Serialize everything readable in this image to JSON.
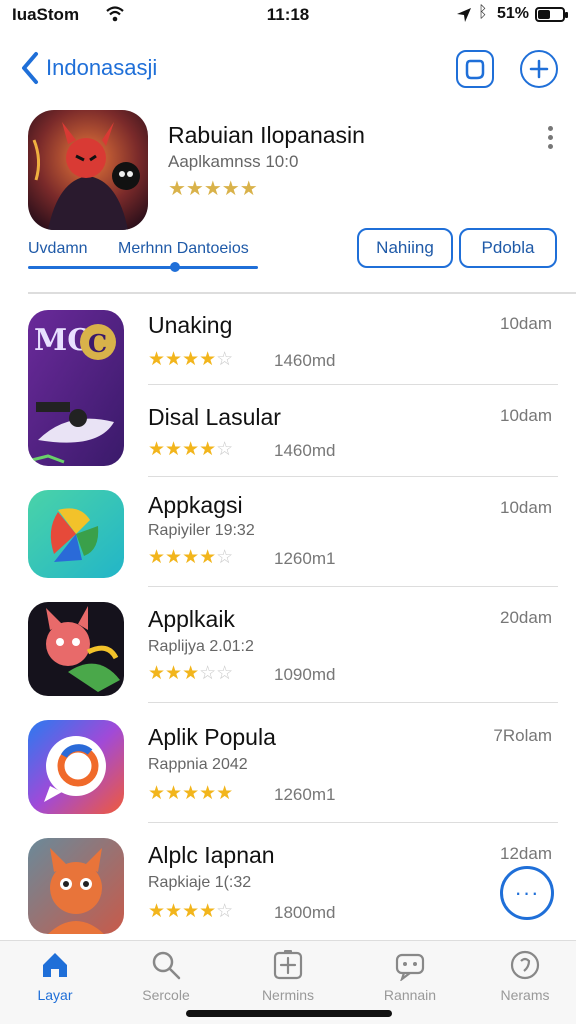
{
  "status_bar": {
    "carrier": "IuaStom",
    "time": "11:18",
    "battery_pct": "51%",
    "battery_level": 0.51,
    "icons": [
      "wifi-icon",
      "location-arrow-icon",
      "bluetooth-icon",
      "battery-icon"
    ]
  },
  "nav": {
    "back_label": "Indonasasji",
    "buttons": [
      "square-icon",
      "plus-icon"
    ]
  },
  "featured": {
    "title": "Rabuian Ilopanasin",
    "subtitle": "Aaplkamnss 10:0",
    "rating": 4,
    "stars": "★★★★★",
    "tab_left": "Uvdamn",
    "tab_right": "Merhnn Dantoeios",
    "slider_value": 0.64,
    "pill_one": "Nahiing",
    "pill_two": "Pdobla"
  },
  "apps": [
    {
      "title": "Unaking",
      "subtitle": "",
      "stars_on": "★★★★",
      "stars_off": "☆",
      "count": "1460md",
      "time": "10dam",
      "icon": "game-art-icon-purple"
    },
    {
      "title": "Disal Lasular",
      "subtitle": "",
      "stars_on": "★★★★",
      "stars_off": "☆",
      "count": "1460md",
      "time": "10dam",
      "icon": "game-art-icon-purple"
    },
    {
      "title": "Appkagsi",
      "subtitle": "Rapiyiler 19:32",
      "stars_on": "★★★★",
      "stars_off": "☆",
      "count": "1260m1",
      "time": "10dam",
      "icon": "pinwheel-icon"
    },
    {
      "title": "Applkaik",
      "subtitle": "Raplijya 2.01:2",
      "stars_on": "★★★",
      "stars_off": "☆☆",
      "count": "1090md",
      "time": "20dam",
      "icon": "fox-character-icon"
    },
    {
      "title": "Aplik Popula",
      "subtitle": "Rappnia 2042",
      "stars_on": "★★★★★",
      "stars_off": "",
      "count": "1260m1",
      "time": "7Rolam",
      "icon": "chat-ring-icon"
    },
    {
      "title": "Alplc Iapnan",
      "subtitle": "Rapkiaje 1(:32",
      "stars_on": "★★★★",
      "stars_off": "☆",
      "count": "1800md",
      "time": "12dam",
      "icon": "cat-character-icon"
    }
  ],
  "fab": {
    "label": "···"
  },
  "tabbar": [
    {
      "label": "Layar",
      "icon": "home-icon"
    },
    {
      "label": "Sercole",
      "icon": "search-icon"
    },
    {
      "label": "Nermins",
      "icon": "plus-square-icon"
    },
    {
      "label": "Rannain",
      "icon": "chat-icon"
    },
    {
      "label": "Nerams",
      "icon": "profile-icon"
    }
  ],
  "colors": {
    "accent": "#1f6fd8",
    "star": "#f2b51c"
  }
}
